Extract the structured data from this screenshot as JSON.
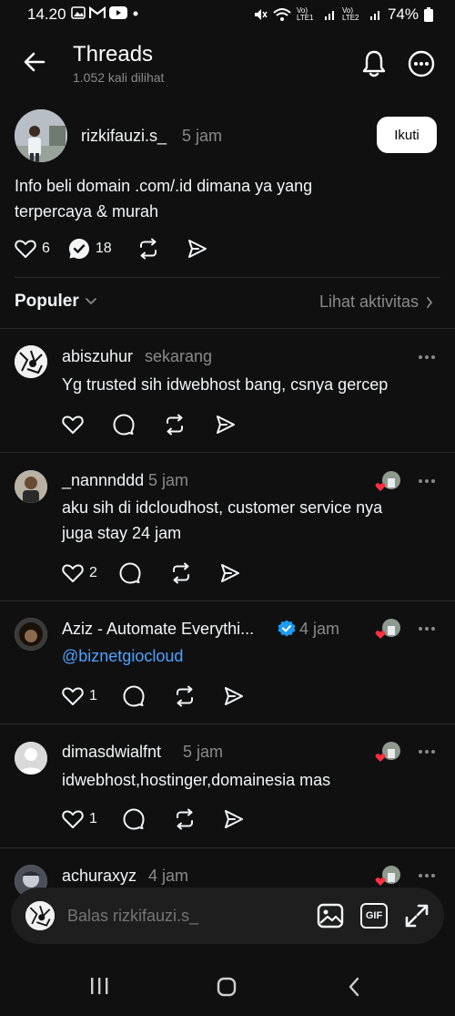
{
  "status_bar": {
    "time": "14.20",
    "battery": "74%",
    "lte1": "Vo) LTE1",
    "lte2": "Vo) LTE2"
  },
  "header": {
    "title": "Threads",
    "subtitle": "1.052 kali dilihat"
  },
  "post": {
    "username": "rizkifauzi.s_",
    "time": "5 jam",
    "follow_label": "Ikuti",
    "text_line1": "Info beli domain .com/.id dimana ya yang",
    "text_line2": "terpercaya & murah",
    "likes": "6",
    "reposts": "18"
  },
  "sort": {
    "label": "Populer",
    "activity_label": "Lihat aktivitas"
  },
  "replies": [
    {
      "username": "abiszuhur",
      "time": "sekarang",
      "text_line1": "Yg trusted sih idwebhost bang, csnya gercep",
      "likes": ""
    },
    {
      "username": "_nannnddd",
      "time": "5 jam",
      "text_line1": "aku sih di idcloudhost, customer service nya",
      "text_line2": "juga stay 24 jam",
      "likes": "2"
    },
    {
      "username": "Aziz - Automate Everythi...",
      "time": "4 jam",
      "mention": "@biznetgiocloud",
      "likes": "1"
    },
    {
      "username": "dimasdwialfnt",
      "time": "5 jam",
      "text_line1": "idwebhost,hostinger,domainesia mas",
      "likes": "1"
    },
    {
      "username": "achuraxyz",
      "time": "4 jam"
    }
  ],
  "reply_bar": {
    "placeholder": "Balas rizkifauzi.s_",
    "gif_label": "GIF"
  },
  "colors": {
    "background": "#101010",
    "link": "#4da3ff",
    "verified": "#1d9bf0",
    "heart_badge": "#ff3040"
  }
}
